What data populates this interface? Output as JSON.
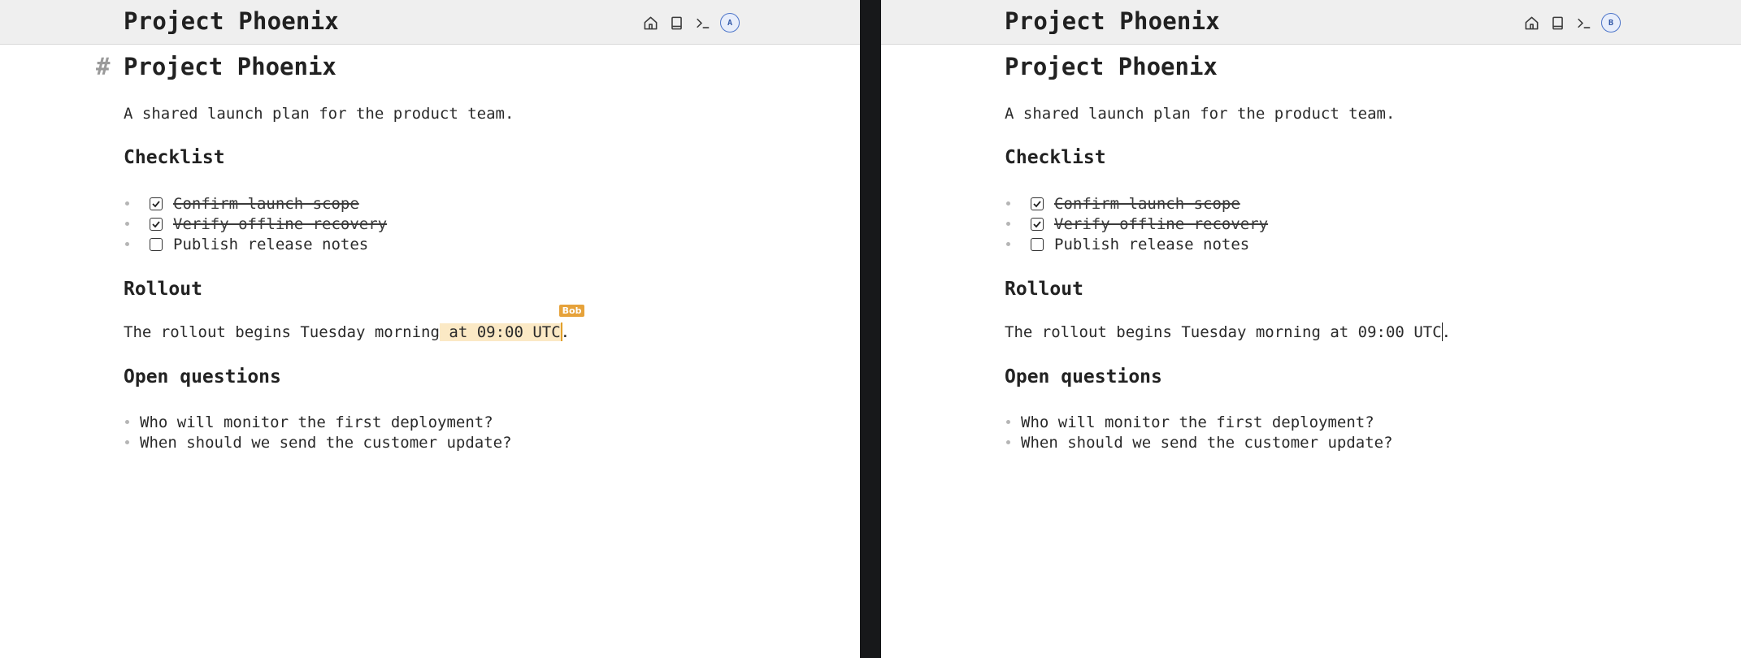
{
  "panes": [
    {
      "user_initial": "A",
      "title": "Project Phoenix",
      "heading": "Project Phoenix",
      "heading_marker": "#",
      "intro": "A shared launch plan for the product team.",
      "checklist_heading": "Checklist",
      "checklist": [
        {
          "text": "Confirm launch scope",
          "checked": true
        },
        {
          "text": "Verify offline recovery",
          "checked": true
        },
        {
          "text": "Publish release notes",
          "checked": false
        }
      ],
      "rollout_heading": "Rollout",
      "rollout_before": "The rollout begins Tuesday morning",
      "rollout_highlight": " at 09:00 UTC",
      "rollout_after": ".",
      "remote_cursor_label": "Bob",
      "questions_heading": "Open questions",
      "questions": [
        "Who will monitor the first deployment?",
        "When should we send the customer update?"
      ]
    },
    {
      "user_initial": "B",
      "title": "Project Phoenix",
      "heading": "Project Phoenix",
      "intro": "A shared launch plan for the product team.",
      "checklist_heading": "Checklist",
      "checklist": [
        {
          "text": "Confirm launch scope",
          "checked": true
        },
        {
          "text": "Verify offline recovery",
          "checked": true
        },
        {
          "text": "Publish release notes",
          "checked": false
        }
      ],
      "rollout_heading": "Rollout",
      "rollout_before": "The rollout begins Tuesday morning at 09:00 UTC",
      "rollout_after": ".",
      "questions_heading": "Open questions",
      "questions": [
        "Who will monitor the first deployment?",
        "When should we send the customer update?"
      ]
    }
  ],
  "icons": [
    "home-icon",
    "book-icon",
    "terminal-icon"
  ],
  "colors": {
    "highlight": "#fbe9c5",
    "remote_cursor": "#e6a23a",
    "avatar": "#4c74c9",
    "divider": "#17181a"
  }
}
